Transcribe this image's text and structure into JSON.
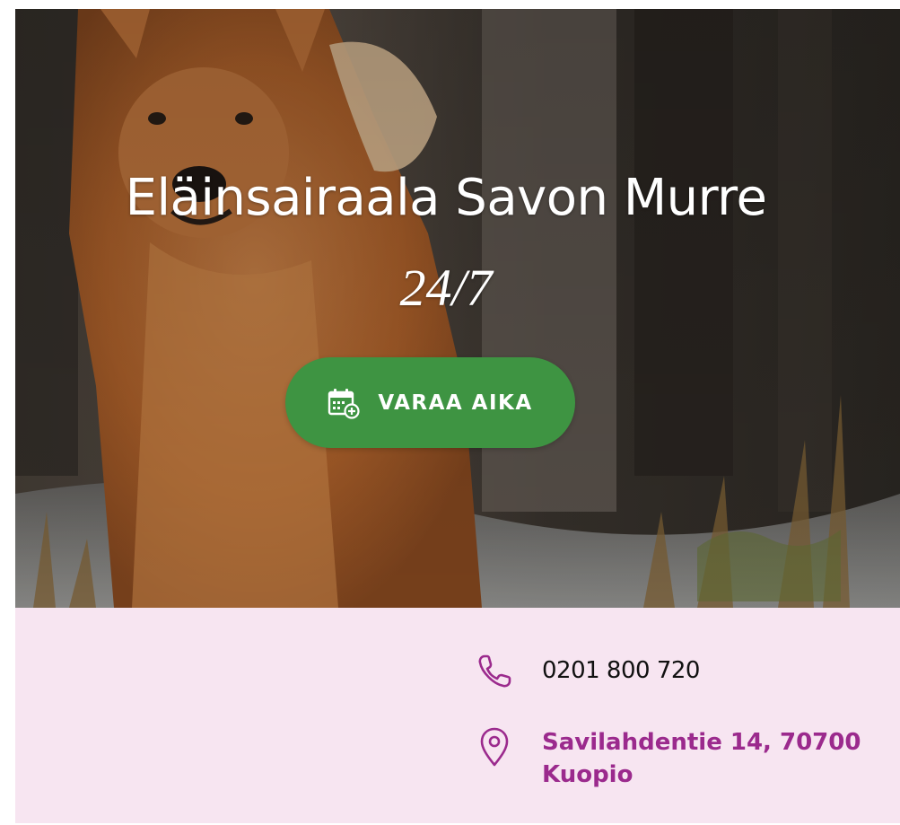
{
  "hero": {
    "title": "Eläinsairaala Savon Murre",
    "subtitle": "24/7",
    "image": "finnish-spitz-dog-in-forest",
    "button": {
      "label": "VARAA AIKA",
      "icon": "calendar-add-icon",
      "color": "#3e9442"
    }
  },
  "contact": {
    "background": "#f7e5f1",
    "accent": "#9b2a8d",
    "phone": {
      "icon": "phone-icon",
      "value": "0201 800 720"
    },
    "address": {
      "icon": "location-pin-icon",
      "value": "Savilahdentie 14, 70700 Kuopio"
    }
  }
}
